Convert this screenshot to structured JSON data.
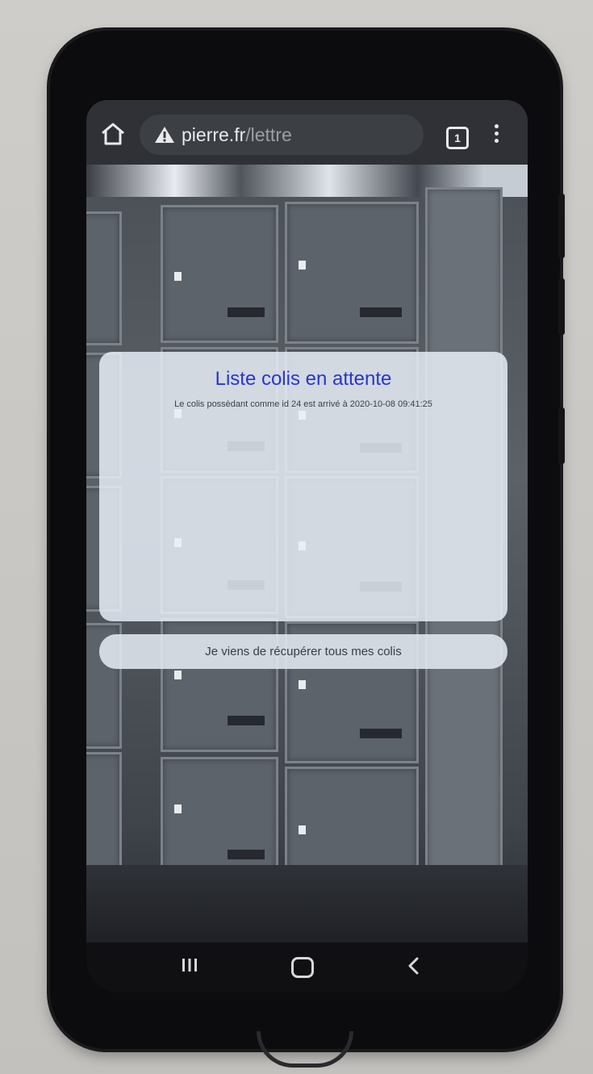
{
  "browser": {
    "url_domain": "pierre.fr",
    "url_path": "/lettre",
    "tab_count": "1",
    "icons": [
      "home-icon",
      "warning-icon",
      "tabs-icon",
      "more-vert-icon"
    ]
  },
  "card": {
    "title": "Liste colis en attente",
    "message": "Le colis possèdant comme id 24 est arrivé à 2020-10-08 09:41:25"
  },
  "action": {
    "button_label": "Je viens de récupérer tous mes colis"
  },
  "navigation": {
    "icons": [
      "recents-icon",
      "home-nav-icon",
      "back-icon"
    ]
  },
  "colors": {
    "title_blue": "#2a36c8",
    "toolbar": "#2f3136",
    "card_background": "#e8f0f8"
  }
}
